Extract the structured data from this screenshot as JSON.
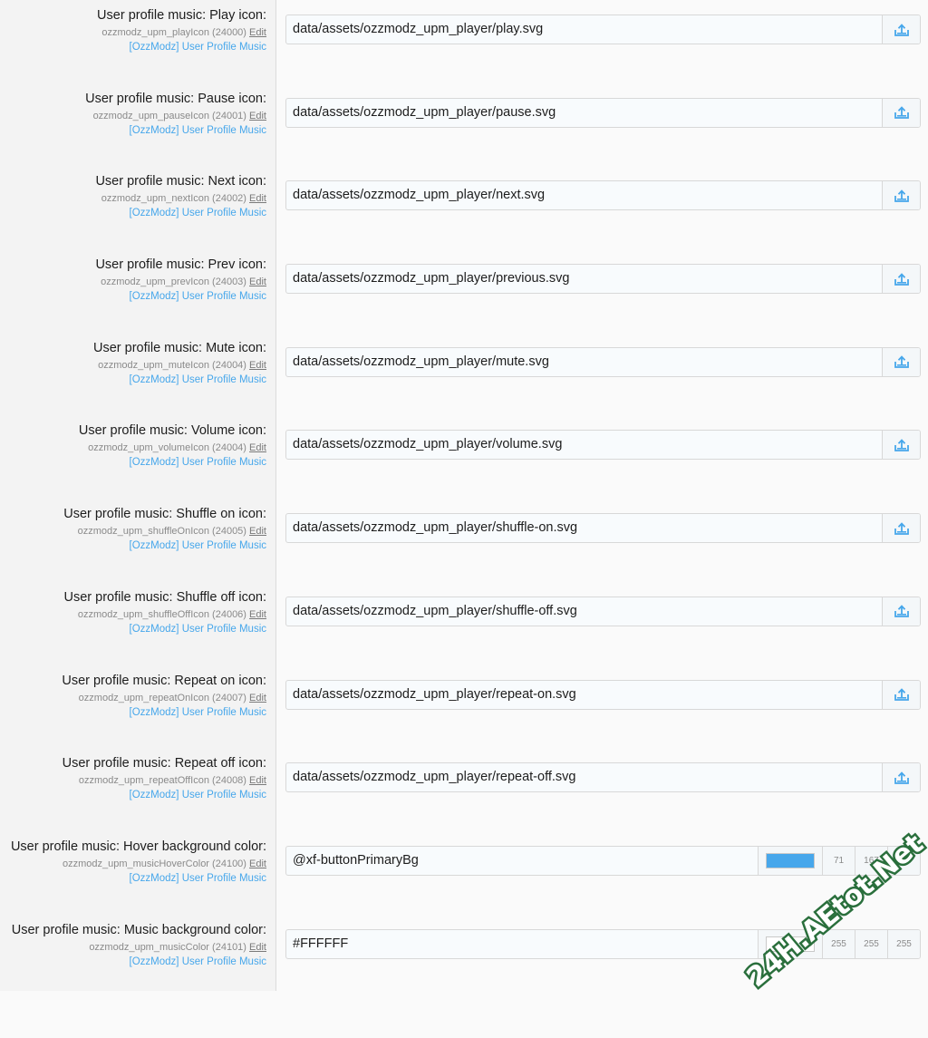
{
  "icon_rows": [
    {
      "title": "User profile music: Play icon:",
      "option_id": "ozzmodz_upm_playIcon",
      "order": "(24000)",
      "edit": "Edit",
      "addon": "[OzzModz] User Profile Music",
      "value": "data/assets/ozzmodz_upm_player/play.svg"
    },
    {
      "title": "User profile music: Pause icon:",
      "option_id": "ozzmodz_upm_pauseIcon",
      "order": "(24001)",
      "edit": "Edit",
      "addon": "[OzzModz] User Profile Music",
      "value": "data/assets/ozzmodz_upm_player/pause.svg"
    },
    {
      "title": "User profile music: Next icon:",
      "option_id": "ozzmodz_upm_nextIcon",
      "order": "(24002)",
      "edit": "Edit",
      "addon": "[OzzModz] User Profile Music",
      "value": "data/assets/ozzmodz_upm_player/next.svg"
    },
    {
      "title": "User profile music: Prev icon:",
      "option_id": "ozzmodz_upm_prevIcon",
      "order": "(24003)",
      "edit": "Edit",
      "addon": "[OzzModz] User Profile Music",
      "value": "data/assets/ozzmodz_upm_player/previous.svg"
    },
    {
      "title": "User profile music: Mute icon:",
      "option_id": "ozzmodz_upm_muteIcon",
      "order": "(24004)",
      "edit": "Edit",
      "addon": "[OzzModz] User Profile Music",
      "value": "data/assets/ozzmodz_upm_player/mute.svg"
    },
    {
      "title": "User profile music: Volume icon:",
      "option_id": "ozzmodz_upm_volumeIcon",
      "order": "(24004)",
      "edit": "Edit",
      "addon": "[OzzModz] User Profile Music",
      "value": "data/assets/ozzmodz_upm_player/volume.svg"
    },
    {
      "title": "User profile music: Shuffle on icon:",
      "option_id": "ozzmodz_upm_shuffleOnIcon",
      "order": "(24005)",
      "edit": "Edit",
      "addon": "[OzzModz] User Profile Music",
      "value": "data/assets/ozzmodz_upm_player/shuffle-on.svg"
    },
    {
      "title": "User profile music: Shuffle off icon:",
      "option_id": "ozzmodz_upm_shuffleOffIcon",
      "order": "(24006)",
      "edit": "Edit",
      "addon": "[OzzModz] User Profile Music",
      "value": "data/assets/ozzmodz_upm_player/shuffle-off.svg"
    },
    {
      "title": "User profile music: Repeat on icon:",
      "option_id": "ozzmodz_upm_repeatOnIcon",
      "order": "(24007)",
      "edit": "Edit",
      "addon": "[OzzModz] User Profile Music",
      "value": "data/assets/ozzmodz_upm_player/repeat-on.svg"
    },
    {
      "title": "User profile music: Repeat off icon:",
      "option_id": "ozzmodz_upm_repeatOffIcon",
      "order": "(24008)",
      "edit": "Edit",
      "addon": "[OzzModz] User Profile Music",
      "value": "data/assets/ozzmodz_upm_player/repeat-off.svg"
    }
  ],
  "color_rows": [
    {
      "title": "User profile music: Hover background color:",
      "option_id": "ozzmodz_upm_musicHoverColor",
      "order": "(24100)",
      "edit": "Edit",
      "addon": "[OzzModz] User Profile Music",
      "value": "@xf-buttonPrimaryBg",
      "swatch": "#47a7eb",
      "r": "71",
      "g": "167",
      "b": "235"
    },
    {
      "title": "User profile music: Music background color:",
      "option_id": "ozzmodz_upm_musicColor",
      "order": "(24101)",
      "edit": "Edit",
      "addon": "[OzzModz] User Profile Music",
      "value": "#FFFFFF",
      "swatch": "#ffffff",
      "r": "255",
      "g": "255",
      "b": "255"
    }
  ],
  "icons": {
    "upload": "upload-icon"
  },
  "watermark": {
    "text": "24H.AEtot.Net",
    "color": "#2a6f3c"
  }
}
